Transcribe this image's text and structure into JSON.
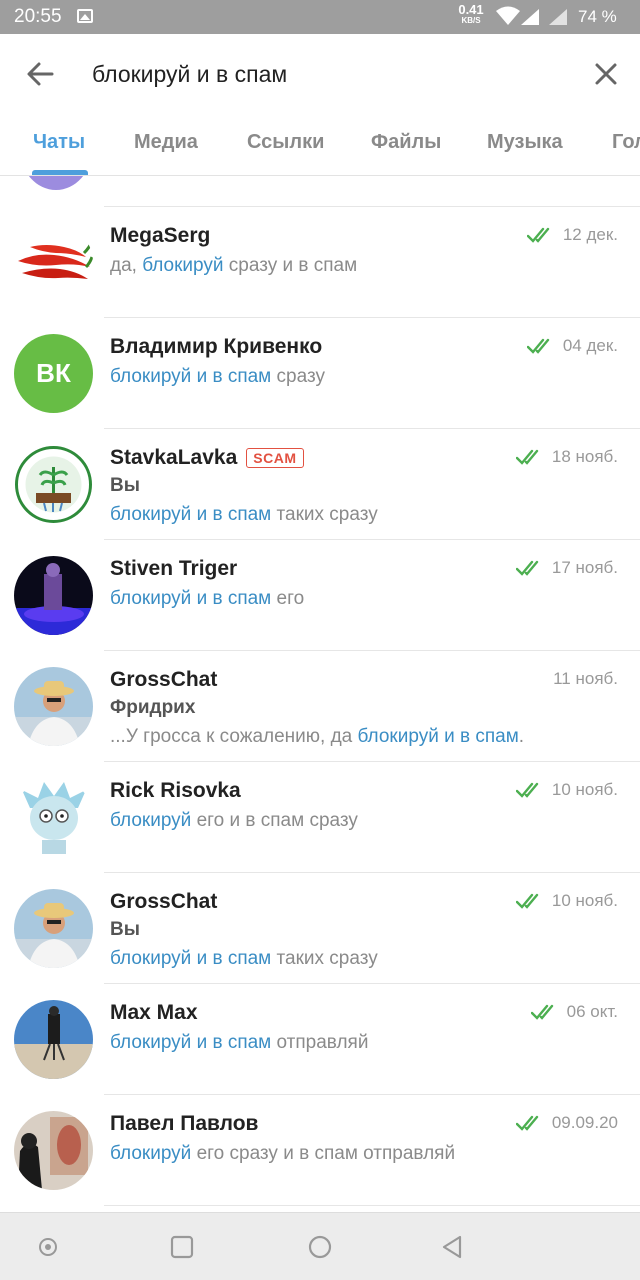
{
  "status_bar": {
    "time": "20:55",
    "net_speed": "0.41",
    "net_speed_unit": "KB/S",
    "battery": "74 %"
  },
  "search": {
    "query": "блокируй и в спам"
  },
  "tabs": [
    {
      "label": "Чаты",
      "active": true
    },
    {
      "label": "Медиа",
      "active": false
    },
    {
      "label": "Ссылки",
      "active": false
    },
    {
      "label": "Файлы",
      "active": false
    },
    {
      "label": "Музыка",
      "active": false
    },
    {
      "label": "Голос",
      "active": false
    }
  ],
  "chats": [
    {
      "name": "MegaSerg",
      "date": "12 дек.",
      "read": true,
      "badge": "",
      "preview": {
        "before": "да, ",
        "highlight": "блокируй",
        "after": " сразу и в спам"
      },
      "sender": ""
    },
    {
      "name": "Владимир Кривенко",
      "date": "04 дек.",
      "read": true,
      "badge": "",
      "initials": "ВК",
      "preview": {
        "before": "",
        "highlight": "блокируй и в спам",
        "after": " сразу"
      },
      "sender": ""
    },
    {
      "name": "StavkaLavka",
      "date": "18 нояб.",
      "read": true,
      "badge": "SCAM",
      "preview": {
        "before": "",
        "highlight": "блокируй и в спам",
        "after": " таких сразу"
      },
      "sender": "Вы"
    },
    {
      "name": "Stiven Triger",
      "date": "17 нояб.",
      "read": true,
      "badge": "",
      "preview": {
        "before": "",
        "highlight": "блокируй и в спам",
        "after": " его"
      },
      "sender": ""
    },
    {
      "name": "GrossChat",
      "date": "11 нояб.",
      "read": false,
      "badge": "",
      "preview": {
        "before": "...У гросса к сожалению, да ",
        "highlight": "блокируй и в спам",
        "after": "."
      },
      "sender": "Фридрих"
    },
    {
      "name": "Rick Risovka",
      "date": "10 нояб.",
      "read": true,
      "badge": "",
      "preview": {
        "before": "",
        "highlight": "блокируй",
        "after": " его и в спам сразу"
      },
      "sender": ""
    },
    {
      "name": "GrossChat",
      "date": "10 нояб.",
      "read": true,
      "badge": "",
      "preview": {
        "before": "",
        "highlight": "блокируй и в спам",
        "after": " таких сразу"
      },
      "sender": "Вы"
    },
    {
      "name": "Max Max",
      "date": "06 окт.",
      "read": true,
      "badge": "",
      "preview": {
        "before": "",
        "highlight": "блокируй и в спам",
        "after": " отправляй"
      },
      "sender": ""
    },
    {
      "name": "Павел Павлов",
      "date": "09.09.20",
      "read": true,
      "badge": "",
      "preview": {
        "before": "",
        "highlight": "блокируй",
        "after": " его сразу и в спам отправляй"
      },
      "sender": ""
    }
  ],
  "colors": {
    "accent": "#4e9fdc",
    "highlight": "#3a8dc4",
    "read_check": "#4caf50",
    "scam": "#e25141",
    "avatar_vk": "#67bd45"
  }
}
